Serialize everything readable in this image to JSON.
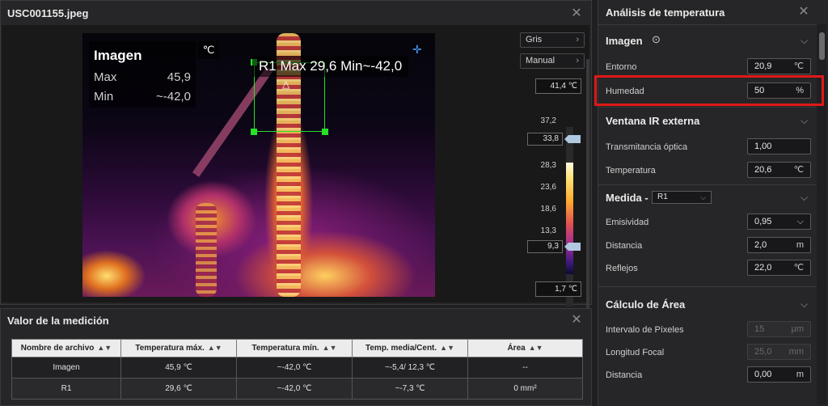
{
  "image_panel": {
    "title": "USC001155.jpeg",
    "overlay": {
      "heading": "Imagen",
      "max_label": "Max",
      "max_value": "45,9",
      "min_label": "Min",
      "min_value": "~-42,0",
      "unit": "℃"
    },
    "r1_label": "R1  Max 29,6  Min~-42,0",
    "palette_button": "Gris",
    "mode_button": "Manual",
    "scale_top": "41,4 ℃",
    "scale_bottom": "1,7 ℃",
    "scale_ticks": [
      "37,2",
      "28,3",
      "23,6",
      "18,6",
      "13,3"
    ],
    "scale_upper_value": "33,8",
    "scale_lower_value": "9,3"
  },
  "measurement_panel": {
    "title": "Valor de la medición",
    "columns": [
      "Nombre de archivo",
      "Temperatura máx.",
      "Temperatura mín.",
      "Temp. media/Cent.",
      "Área"
    ],
    "rows": [
      [
        "Imagen",
        "45,9 ℃",
        "~-42,0 ℃",
        "~-5,4/ 12,3 ℃",
        "--"
      ],
      [
        "R1",
        "29,6 ℃",
        "~-42,0 ℃",
        "~-7,3 ℃",
        "0 mm²"
      ]
    ]
  },
  "right_panel": {
    "title": "Análisis de temperatura",
    "imagen": {
      "title": "Imagen",
      "entorno_label": "Entorno",
      "entorno_value": "20,9",
      "entorno_unit": "℃",
      "humedad_label": "Humedad",
      "humedad_value": "50",
      "humedad_unit": "%"
    },
    "ventana": {
      "title": "Ventana IR externa",
      "trans_label": "Transmitancia óptica",
      "trans_value": "1,00",
      "temp_label": "Temperatura",
      "temp_value": "20,6",
      "temp_unit": "℃"
    },
    "medida": {
      "title": "Medida  -",
      "selected": "R1",
      "emis_label": "Emisividad",
      "emis_value": "0,95",
      "dist_label": "Distancia",
      "dist_value": "2,0",
      "dist_unit": "m",
      "refl_label": "Reflejos",
      "refl_value": "22,0",
      "refl_unit": "℃"
    },
    "area": {
      "title": "Cálculo de Área",
      "pix_label": "Intervalo de Píxeles",
      "pix_value": "15",
      "pix_unit": "μm",
      "focal_label": "Longitud Focal",
      "focal_value": "25,0",
      "focal_unit": "mm",
      "dist_label": "Distancia",
      "dist_value": "0,00",
      "dist_unit": "m"
    }
  }
}
